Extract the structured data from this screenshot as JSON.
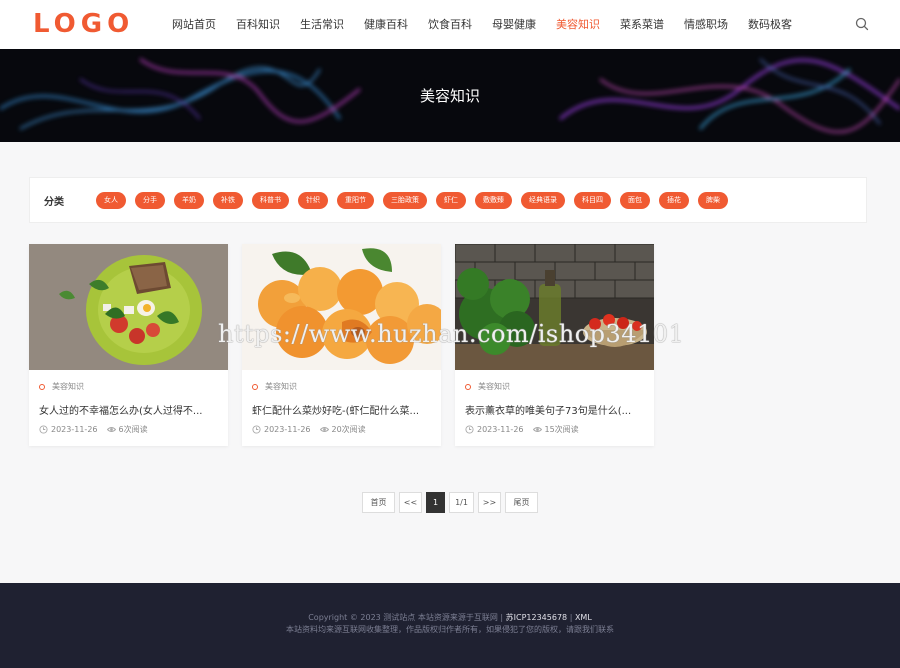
{
  "header": {
    "logo": "LOGO",
    "nav": [
      "网站首页",
      "百科知识",
      "生活常识",
      "健康百科",
      "饮食百科",
      "母婴健康",
      "美容知识",
      "菜系菜谱",
      "情感职场",
      "数码极客"
    ],
    "active_index": 6,
    "accent": "#f05a32"
  },
  "banner": {
    "title": "美容知识"
  },
  "categories": {
    "label": "分类",
    "tags": [
      "女人",
      "分手",
      "羊奶",
      "补铁",
      "科普书",
      "针织",
      "重阳节",
      "三胎政策",
      "虾仁",
      "敷敷臻",
      "经典语录",
      "科目四",
      "面包",
      "插花",
      "脾柴"
    ]
  },
  "cards": [
    {
      "category": "美容知识",
      "title": "女人过的不幸福怎么办(女人过得不...",
      "date": "2023-11-26",
      "views": "6次阅读"
    },
    {
      "category": "美容知识",
      "title": "虾仁配什么菜炒好吃-(虾仁配什么菜...",
      "date": "2023-11-26",
      "views": "20次阅读"
    },
    {
      "category": "美容知识",
      "title": "表示薰衣草的唯美句子73句是什么(...",
      "date": "2023-11-26",
      "views": "15次阅读"
    }
  ],
  "pager": {
    "first": "首页",
    "prev": "<<",
    "current": "1",
    "total": "1/1",
    "next": ">>",
    "last": "尾页"
  },
  "watermark": "https://www.huzhan.com/ishop34101",
  "footer": {
    "copyright": "Copyright © 2023 测试站点 本站资源来源于互联网",
    "icp": "苏ICP12345678",
    "xml": "XML",
    "notice": "本站资料均来源互联网收集整理，作品版权归作者所有，如果侵犯了您的版权，请跟我们联系"
  }
}
